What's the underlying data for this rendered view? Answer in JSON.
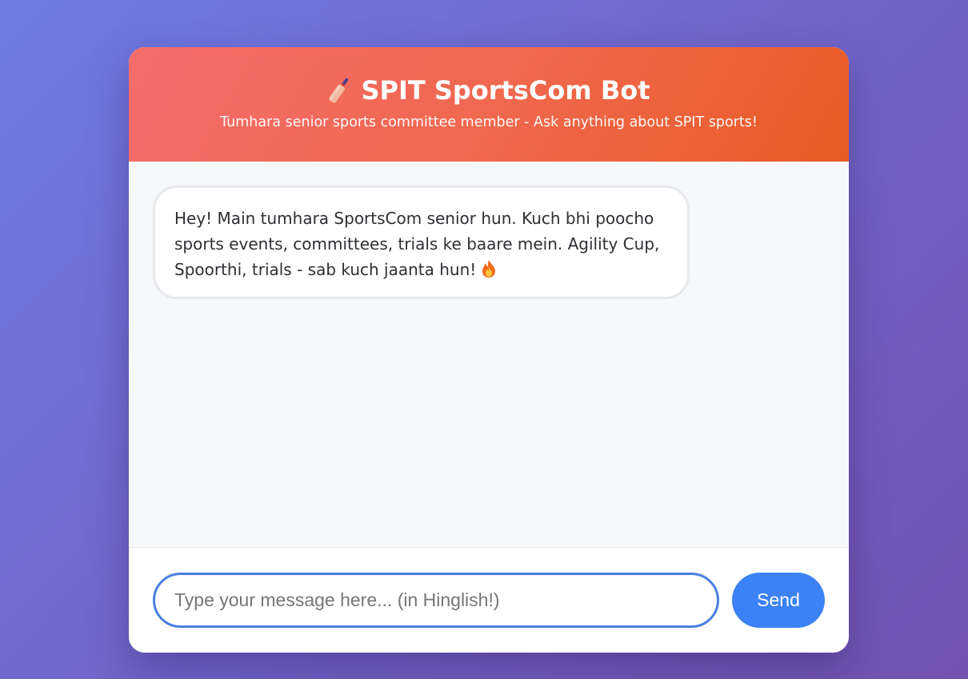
{
  "header": {
    "title": "SPIT SportsCom Bot",
    "subtitle": "Tumhara senior sports committee member - Ask anything about SPIT sports!",
    "icon": "cricket-bat-icon"
  },
  "messages": [
    {
      "sender": "bot",
      "text": "Hey! Main tumhara SportsCom senior hun. Kuch bhi poocho sports events, committees, trials ke baare mein. Agility Cup, Spoorthi, trials - sab kuch jaanta hun!",
      "trailing_icon": "fire-icon"
    }
  ],
  "input": {
    "value": "",
    "placeholder": "Type your message here... (in Hinglish!)"
  },
  "send": {
    "label": "Send"
  },
  "colors": {
    "header_start": "#f56c6c",
    "header_end": "#e85b24",
    "accent": "#3c82f6",
    "background_start": "#6f7be3",
    "background_end": "#7252b0"
  }
}
